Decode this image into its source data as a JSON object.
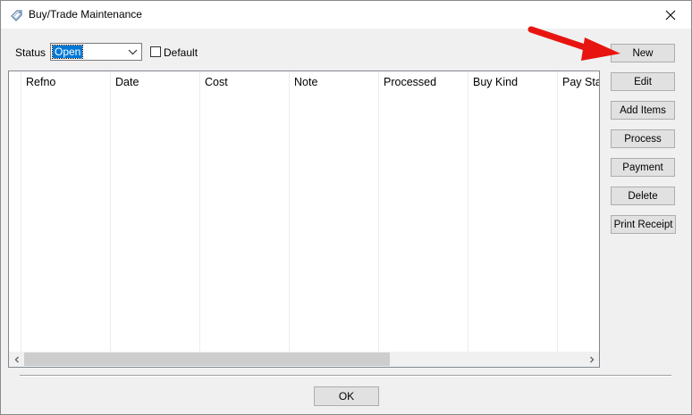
{
  "window": {
    "title": "Buy/Trade Maintenance",
    "title_icon": "tag-icon",
    "close_icon": "close-icon"
  },
  "filter": {
    "status_label": "Status",
    "status_value": "Open",
    "default_label": "Default",
    "default_checked": false
  },
  "grid": {
    "columns": [
      "Refno",
      "Date",
      "Cost",
      "Note",
      "Processed",
      "Buy Kind",
      "Pay Sta"
    ],
    "rows": []
  },
  "buttons": {
    "new": "New",
    "edit": "Edit",
    "add_items": "Add Items",
    "process": "Process",
    "payment": "Payment",
    "delete": "Delete",
    "print_receipt": "Print Receipt"
  },
  "footer": {
    "ok": "OK"
  },
  "annotation": {
    "color": "#e8140f"
  }
}
